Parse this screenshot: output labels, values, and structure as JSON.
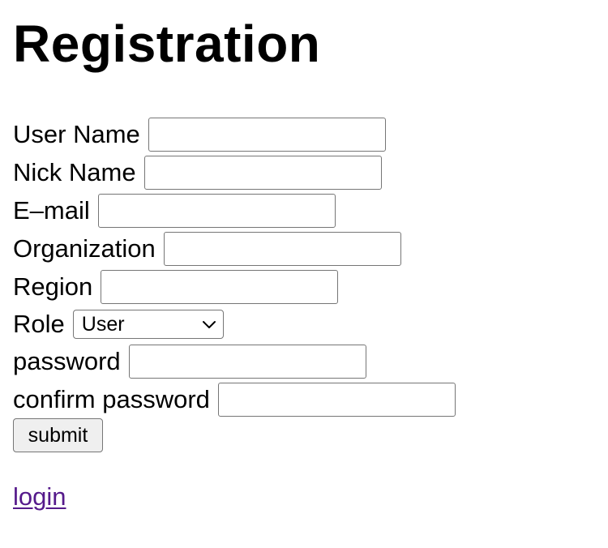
{
  "page": {
    "title": "Registration"
  },
  "form": {
    "fields": [
      {
        "label": "User Name",
        "value": ""
      },
      {
        "label": "Nick Name",
        "value": ""
      },
      {
        "label": "E–mail",
        "value": ""
      },
      {
        "label": "Organization",
        "value": ""
      },
      {
        "label": "Region",
        "value": ""
      },
      {
        "label": "Role",
        "selected": "User"
      },
      {
        "label": "password",
        "value": ""
      },
      {
        "label": "confirm password",
        "value": ""
      }
    ],
    "submit_label": "submit"
  },
  "footer": {
    "login_link": "login",
    "link_color": "#551a8b"
  },
  "icons": {
    "role_select_indicator": "chevron-down-icon"
  }
}
